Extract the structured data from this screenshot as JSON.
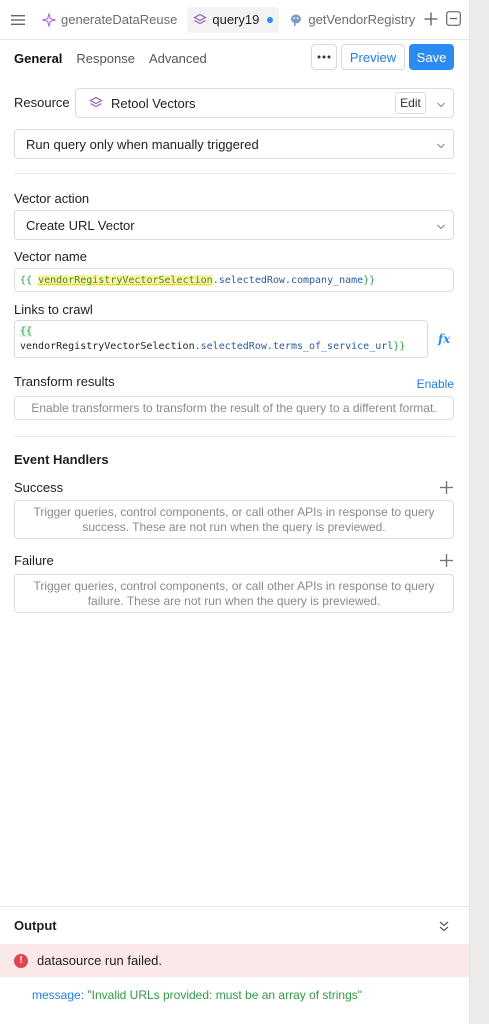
{
  "tabs": [
    {
      "label": "generateDataReuse"
    },
    {
      "label": "query19"
    },
    {
      "label": "getVendorRegistry"
    }
  ],
  "subtabs": {
    "general": "General",
    "response": "Response",
    "advanced": "Advanced"
  },
  "actions": {
    "preview": "Preview",
    "save": "Save"
  },
  "resource": {
    "label": "Resource",
    "value": "Retool Vectors",
    "edit": "Edit"
  },
  "trigger": {
    "value": "Run query only when manually triggered"
  },
  "vector_action": {
    "label": "Vector action",
    "value": "Create URL Vector"
  },
  "vector_name": {
    "label": "Vector name",
    "open": "{{",
    "var": "vendorRegistryVectorSelection",
    "prop": ".selectedRow.company_name",
    "close": "}}"
  },
  "links": {
    "label": "Links to crawl",
    "open": "{{",
    "var": "vendorRegistryVectorSelection",
    "prop": ".selectedRow.terms_of_service_url",
    "close": "}}",
    "fx": "fx"
  },
  "transform": {
    "label": "Transform results",
    "enable": "Enable",
    "placeholder": "Enable transformers to transform the result of the query to a different format."
  },
  "events": {
    "title": "Event Handlers",
    "success_label": "Success",
    "success_text": "Trigger queries, control components, or call other APIs in response to query success. These are not run when the query is previewed.",
    "failure_label": "Failure",
    "failure_text": "Trigger queries, control components, or call other APIs in response to query failure. These are not run when the query is previewed."
  },
  "output": {
    "title": "Output",
    "error": "datasource run failed.",
    "msg_key": "message:",
    "msg_value": "\"Invalid URLs provided: must be an array of strings\""
  },
  "colors": {
    "accent": "#2a8cf0",
    "error_bg": "#fbe9ea",
    "error_icon": "#e0454f",
    "vector_purple": "#9b59b6"
  },
  "icons": [
    "menu-icon",
    "sparkle-icon",
    "vector-stack-icon",
    "unsaved-dot",
    "postgres-icon",
    "plus-icon",
    "minimize-icon",
    "more-icon",
    "chevron-down-icon",
    "fx-icon",
    "error-icon",
    "collapse-icon"
  ]
}
